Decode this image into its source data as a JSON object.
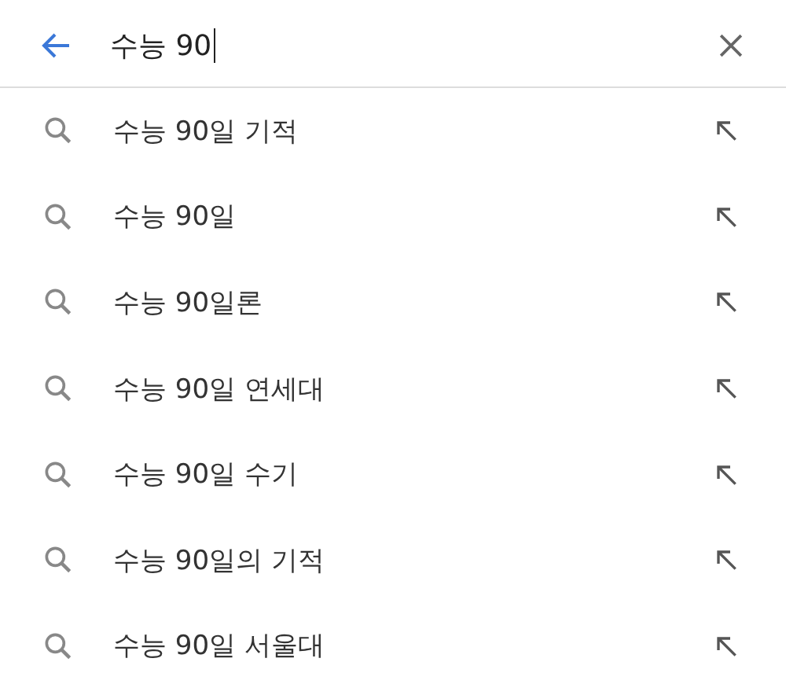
{
  "search": {
    "value": "수능 90",
    "focused": true
  },
  "suggestions": [
    {
      "text": "수능 90일 기적"
    },
    {
      "text": "수능 90일"
    },
    {
      "text": "수능 90일론"
    },
    {
      "text": "수능 90일 연세대"
    },
    {
      "text": "수능 90일 수기"
    },
    {
      "text": "수능 90일의 기적"
    },
    {
      "text": "수능 90일 서울대"
    }
  ]
}
